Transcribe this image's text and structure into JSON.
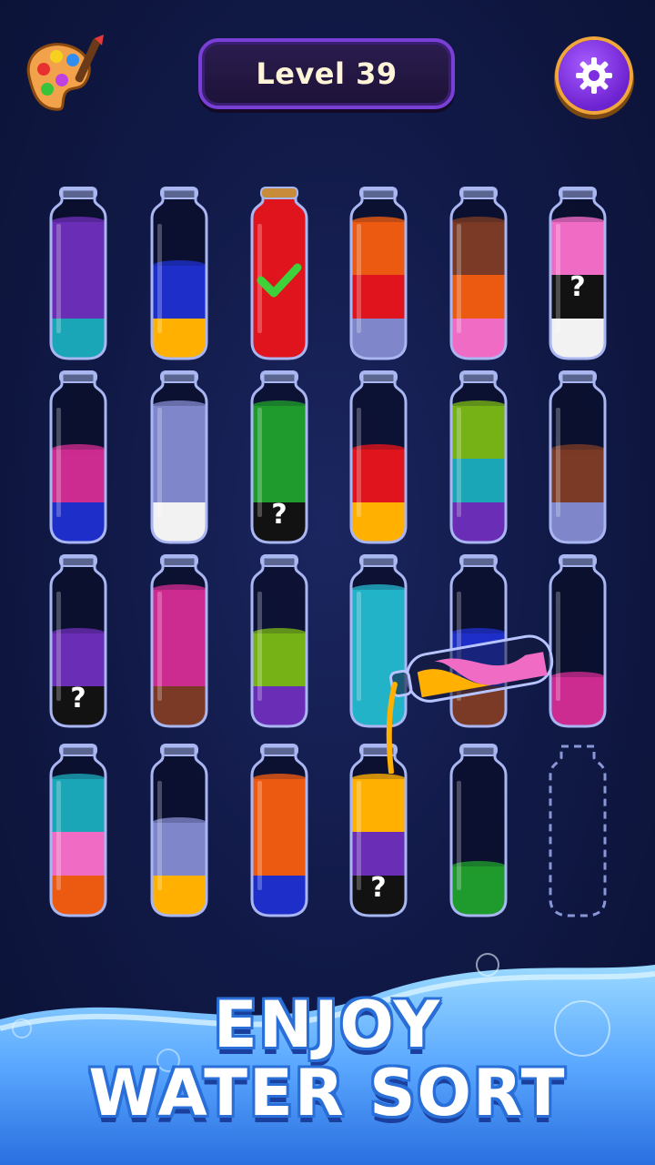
{
  "header": {
    "level_label": "Level 39",
    "palette_icon": "paint-palette-icon",
    "settings_icon": "gear-icon"
  },
  "colors": {
    "purple": "#6a2db5",
    "teal": "#1aa6b7",
    "blue": "#1e2fc9",
    "yellow": "#ffb000",
    "red": "#e0141c",
    "orange": "#ec5a12",
    "brown": "#7a3a26",
    "pink": "#f06cc4",
    "black": "#121212",
    "white": "#f2f2f2",
    "lavender": "#7f86c9",
    "magenta": "#cc2b8f",
    "green": "#1f9a2c",
    "lime": "#76b215",
    "cyan": "#22b3c8"
  },
  "tubes": [
    {
      "segments": [
        "teal",
        "purple",
        "purple"
      ],
      "hidden": []
    },
    {
      "segments": [
        "yellow",
        "blue"
      ],
      "hidden": []
    },
    {
      "segments": [
        "red",
        "red",
        "red",
        "red"
      ],
      "hidden": [],
      "complete": true
    },
    {
      "segments": [
        "lavender",
        "red",
        "orange"
      ],
      "hidden": []
    },
    {
      "segments": [
        "pink",
        "orange",
        "brown"
      ],
      "hidden": []
    },
    {
      "segments": [
        "white",
        "black",
        "pink"
      ],
      "hidden": [
        1
      ]
    },
    {
      "segments": [
        "blue",
        "magenta"
      ],
      "hidden": []
    },
    {
      "segments": [
        "white",
        "lavender",
        "lavender"
      ],
      "hidden": []
    },
    {
      "segments": [
        "black",
        "green",
        "green"
      ],
      "hidden": [
        0
      ]
    },
    {
      "segments": [
        "yellow",
        "red"
      ],
      "hidden": []
    },
    {
      "segments": [
        "purple",
        "teal",
        "lime"
      ],
      "hidden": []
    },
    {
      "segments": [
        "lavender",
        "brown"
      ],
      "hidden": []
    },
    {
      "segments": [
        "black",
        "purple"
      ],
      "hidden": [
        0
      ]
    },
    {
      "segments": [
        "brown",
        "magenta",
        "magenta"
      ],
      "hidden": []
    },
    {
      "segments": [
        "purple",
        "lime"
      ],
      "hidden": []
    },
    {
      "segments": [
        "cyan",
        "cyan",
        "cyan"
      ],
      "hidden": []
    },
    {
      "segments": [
        "brown",
        "blue"
      ],
      "hidden": []
    },
    {
      "segments": [
        "magenta"
      ],
      "hidden": []
    },
    {
      "segments": [
        "orange",
        "pink",
        "teal"
      ],
      "hidden": []
    },
    {
      "segments": [
        "yellow",
        "lavender"
      ],
      "hidden": []
    },
    {
      "segments": [
        "blue",
        "orange",
        "orange"
      ],
      "hidden": []
    },
    {
      "segments": [
        "black",
        "purple",
        "yellow"
      ],
      "hidden": [
        0
      ]
    },
    {
      "segments": [
        "green"
      ],
      "hidden": []
    },
    {
      "segments": [],
      "hidden": [],
      "empty_slot": true
    }
  ],
  "pouring_tube": {
    "colors": [
      "yellow",
      "pink"
    ],
    "stream_color": "yellow"
  },
  "hidden_symbol": "?",
  "slogan": {
    "line1": "ENJOY",
    "line2": "WATER SORT"
  }
}
